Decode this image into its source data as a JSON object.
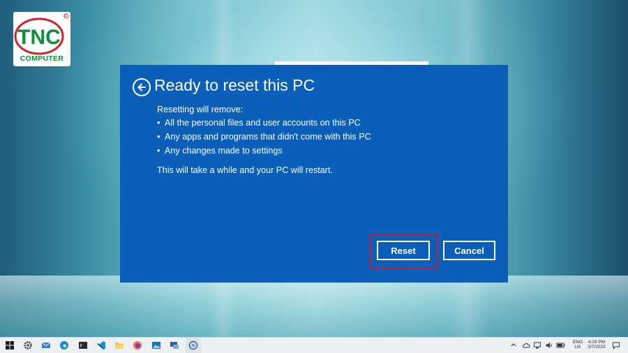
{
  "logo": {
    "brand": "TNC",
    "subtitle": "COMPUTER"
  },
  "dialog": {
    "title": "Ready to reset this PC",
    "intro": "Resetting will remove:",
    "bullet_symbol": "•",
    "bullets": [
      "All the personal files and user accounts on this PC",
      "Any apps and programs that didn't come with this PC",
      "Any changes made to settings"
    ],
    "note": "This will take a while and your PC will restart.",
    "reset_label": "Reset",
    "cancel_label": "Cancel",
    "accent_color": "#0b5fb8",
    "highlight_color": "#c0203a"
  },
  "taskbar": {
    "icons": [
      "windows-start-icon",
      "settings-icon",
      "mail-icon",
      "edge-icon",
      "terminal-icon",
      "vscode-icon",
      "file-explorer-icon",
      "firefox-icon",
      "photos-icon",
      "remote-desktop-icon",
      "system-reset-icon"
    ],
    "language_top": "ENG",
    "language_bottom": "US",
    "time": "4:29 PM",
    "date": "3/7/2023"
  }
}
